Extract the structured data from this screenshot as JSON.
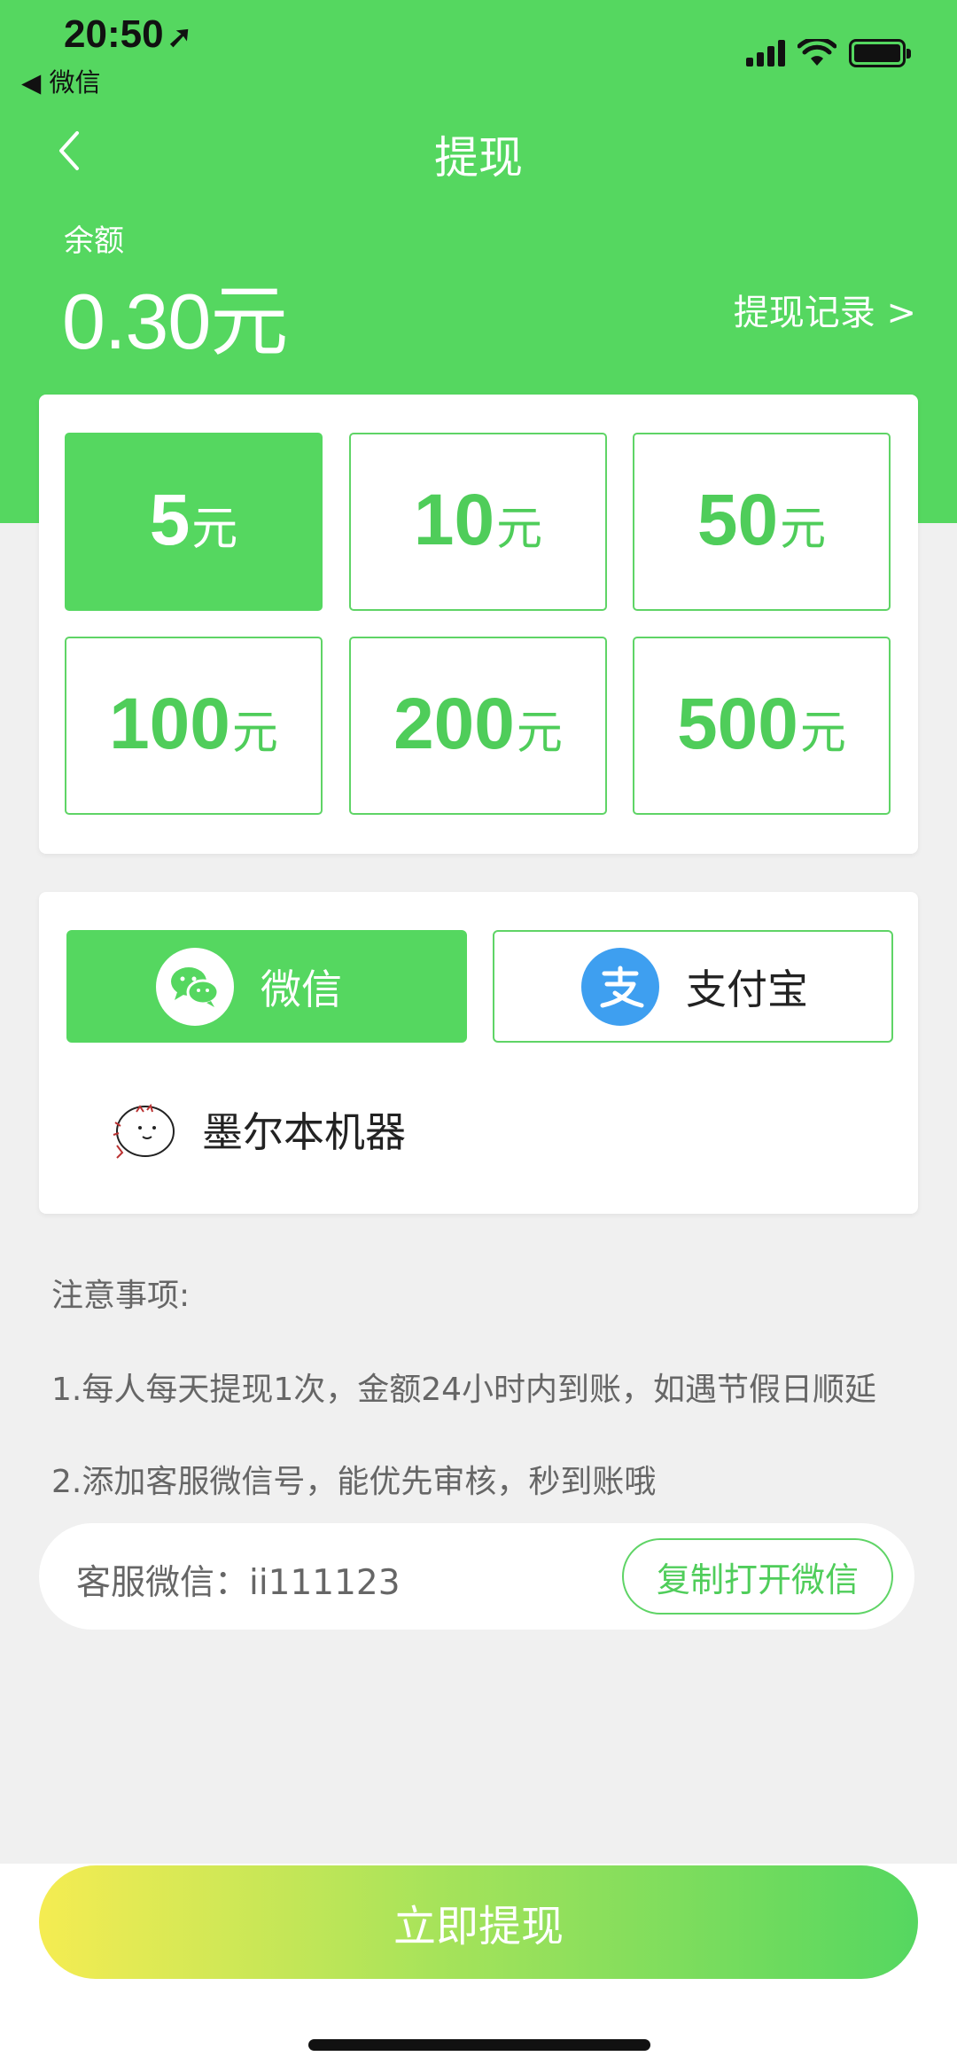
{
  "status_bar": {
    "time": "20:50",
    "back_app": "◀ 微信"
  },
  "header": {
    "title": "提现",
    "balance_label": "余额",
    "balance_value": "0.30元",
    "record_link": "提现记录 >"
  },
  "amounts": [
    {
      "value": "5",
      "unit": "元",
      "selected": true
    },
    {
      "value": "10",
      "unit": "元",
      "selected": false
    },
    {
      "value": "50",
      "unit": "元",
      "selected": false
    },
    {
      "value": "100",
      "unit": "元",
      "selected": false
    },
    {
      "value": "200",
      "unit": "元",
      "selected": false
    },
    {
      "value": "500",
      "unit": "元",
      "selected": false
    }
  ],
  "payment": {
    "wechat_label": "微信",
    "alipay_label": "支付宝",
    "selected": "wechat",
    "account_name": "墨尔本机器"
  },
  "notes": {
    "title": "注意事项:",
    "line1": "1.每人每天提现1次，金额24小时内到账，如遇节假日顺延",
    "line2": "2.添加客服微信号，能优先审核，秒到账哦"
  },
  "customer_service": {
    "text": "客服微信：ii111123",
    "copy_button": "复制打开微信"
  },
  "submit_button": "立即提现",
  "colors": {
    "primary_green": "#55d760",
    "alipay_blue": "#3e9ff0",
    "gradient_start": "#f5ec52"
  }
}
